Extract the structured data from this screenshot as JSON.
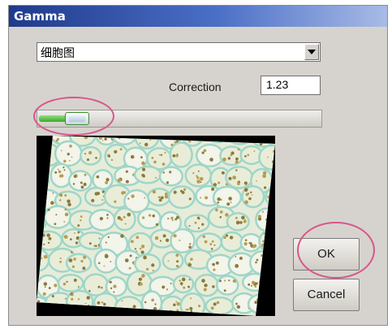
{
  "window": {
    "title": "Gamma"
  },
  "preset_select": {
    "value": "细胞图"
  },
  "correction": {
    "label": "Correction",
    "value": "1.23"
  },
  "slider": {
    "position_fraction": 0.13
  },
  "buttons": {
    "ok": "OK",
    "cancel": "Cancel"
  },
  "icons": {
    "dropdown": "chevron-down-icon"
  },
  "colors": {
    "title_bar": "#1f3a8a",
    "highlight_ring": "#d9558b",
    "slider_fill": "#3aa82e",
    "cell_stain": "#9fd6c8"
  }
}
